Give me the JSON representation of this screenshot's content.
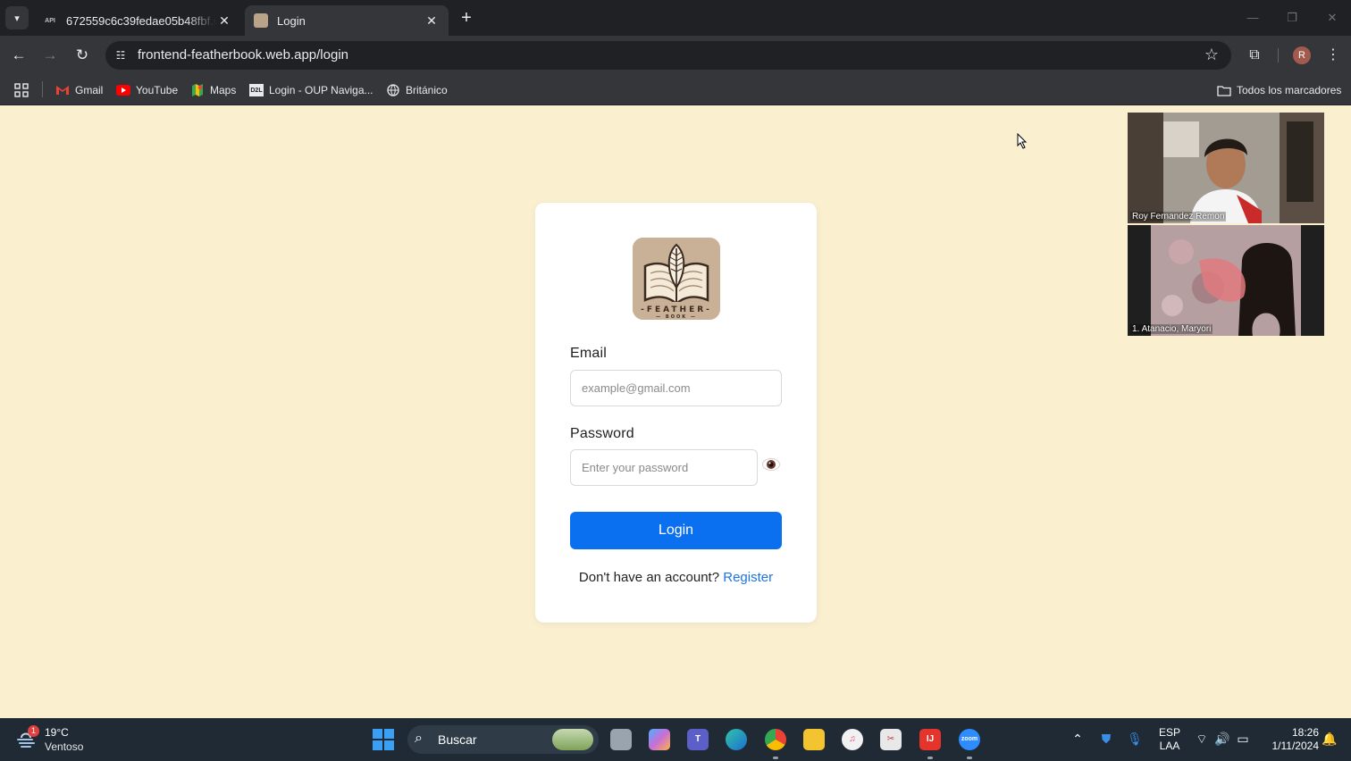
{
  "browser": {
    "tabs": [
      {
        "title": "672559c6c39fedae05b48fbf.md",
        "favicon": "API"
      },
      {
        "title": "Login",
        "favicon": "book-icon"
      }
    ],
    "url": "frontend-featherbook.web.app/login",
    "bookmarks": [
      {
        "label": "Gmail"
      },
      {
        "label": "YouTube"
      },
      {
        "label": "Maps"
      },
      {
        "label": "Login - OUP Naviga..."
      },
      {
        "label": "Británico"
      }
    ],
    "all_bookmarks_label": "Todos los marcadores",
    "profile_initial": "R"
  },
  "login": {
    "email_label": "Email",
    "email_placeholder": "example@gmail.com",
    "password_label": "Password",
    "password_placeholder": "Enter your password",
    "login_button": "Login",
    "no_account_text": "Don't have an account?",
    "register_link": "Register",
    "accent_color": "#0a70f0"
  },
  "video_call": {
    "participants": [
      {
        "name": "Roy Fernandez Remon"
      },
      {
        "name": "1. Atanacio, Maryori"
      }
    ]
  },
  "taskbar": {
    "weather_badge": "1",
    "temperature": "19°C",
    "condition": "Ventoso",
    "search_label": "Buscar",
    "lang_line1": "ESP",
    "lang_line2": "LAA",
    "time": "18:26",
    "date": "1/11/2024"
  }
}
